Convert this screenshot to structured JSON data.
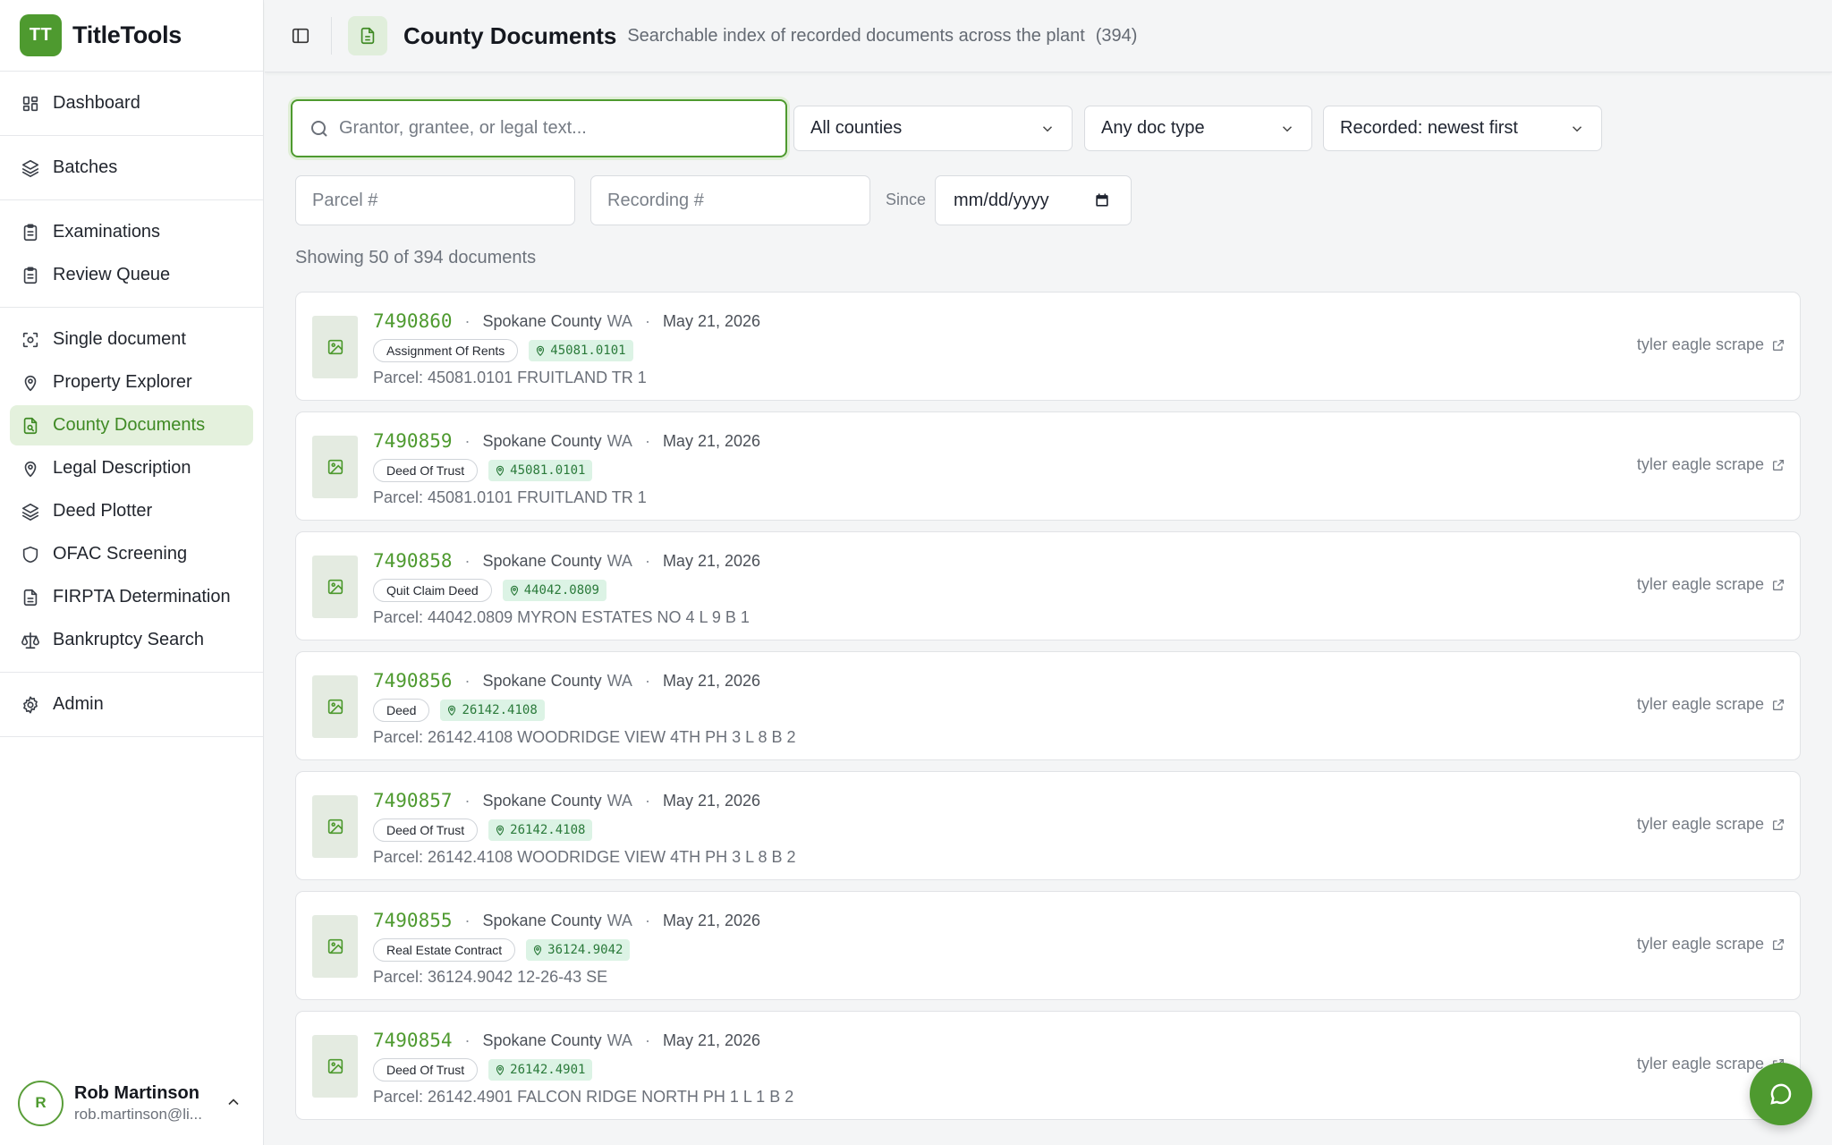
{
  "brand": {
    "logo": "TT",
    "name": "TitleTools",
    "accent": "#4e9a2f"
  },
  "sidebar": {
    "groups": [
      [
        {
          "label": "Dashboard",
          "icon": "dashboard-icon"
        }
      ],
      [
        {
          "label": "Batches",
          "icon": "layers-icon"
        }
      ],
      [
        {
          "label": "Examinations",
          "icon": "clipboard-icon"
        },
        {
          "label": "Review Queue",
          "icon": "clipboard-icon"
        }
      ],
      [
        {
          "label": "Single document",
          "icon": "scan-icon"
        },
        {
          "label": "Property Explorer",
          "icon": "map-pin-icon"
        },
        {
          "label": "County Documents",
          "icon": "document-search-icon",
          "active": true
        },
        {
          "label": "Legal Description",
          "icon": "map-pin-icon"
        },
        {
          "label": "Deed Plotter",
          "icon": "layers-icon"
        },
        {
          "label": "OFAC Screening",
          "icon": "shield-icon"
        },
        {
          "label": "FIRPTA Determination",
          "icon": "document-icon"
        },
        {
          "label": "Bankruptcy Search",
          "icon": "scale-icon"
        }
      ],
      [
        {
          "label": "Admin",
          "icon": "gear-icon"
        }
      ]
    ]
  },
  "user": {
    "initial": "R",
    "name": "Rob Martinson",
    "email": "rob.martinson@li..."
  },
  "header": {
    "title": "County Documents",
    "subtitle": "Searchable index of recorded documents across the plant",
    "count": "(394)"
  },
  "filters": {
    "search_placeholder": "Grantor, grantee, or legal text...",
    "county": "All counties",
    "doc_type": "Any doc type",
    "sort": "Recorded: newest first",
    "parcel_placeholder": "Parcel #",
    "recording_placeholder": "Recording #",
    "since_label": "Since",
    "date_placeholder": "mm/dd/yyyy"
  },
  "showing": "Showing 50 of 394 documents",
  "documents": [
    {
      "number": "7490860",
      "county": "Spokane County",
      "state": "WA",
      "date": "May 21, 2026",
      "type": "Assignment Of Rents",
      "parcel": "45081.0101",
      "parcel_line": "Parcel: 45081.0101 FRUITLAND TR 1",
      "source": "tyler eagle scrape"
    },
    {
      "number": "7490859",
      "county": "Spokane County",
      "state": "WA",
      "date": "May 21, 2026",
      "type": "Deed Of Trust",
      "parcel": "45081.0101",
      "parcel_line": "Parcel: 45081.0101 FRUITLAND TR 1",
      "source": "tyler eagle scrape"
    },
    {
      "number": "7490858",
      "county": "Spokane County",
      "state": "WA",
      "date": "May 21, 2026",
      "type": "Quit Claim Deed",
      "parcel": "44042.0809",
      "parcel_line": "Parcel: 44042.0809 MYRON ESTATES NO 4 L 9 B 1",
      "source": "tyler eagle scrape"
    },
    {
      "number": "7490856",
      "county": "Spokane County",
      "state": "WA",
      "date": "May 21, 2026",
      "type": "Deed",
      "parcel": "26142.4108",
      "parcel_line": "Parcel: 26142.4108 WOODRIDGE VIEW 4TH PH 3 L 8 B 2",
      "source": "tyler eagle scrape"
    },
    {
      "number": "7490857",
      "county": "Spokane County",
      "state": "WA",
      "date": "May 21, 2026",
      "type": "Deed Of Trust",
      "parcel": "26142.4108",
      "parcel_line": "Parcel: 26142.4108 WOODRIDGE VIEW 4TH PH 3 L 8 B 2",
      "source": "tyler eagle scrape"
    },
    {
      "number": "7490855",
      "county": "Spokane County",
      "state": "WA",
      "date": "May 21, 2026",
      "type": "Real Estate Contract",
      "parcel": "36124.9042",
      "parcel_line": "Parcel: 36124.9042 12-26-43 SE",
      "source": "tyler eagle scrape"
    },
    {
      "number": "7490854",
      "county": "Spokane County",
      "state": "WA",
      "date": "May 21, 2026",
      "type": "Deed Of Trust",
      "parcel": "26142.4901",
      "parcel_line": "Parcel: 26142.4901 FALCON RIDGE NORTH PH 1 L 1 B 2",
      "source": "tyler eagle scrape"
    }
  ]
}
